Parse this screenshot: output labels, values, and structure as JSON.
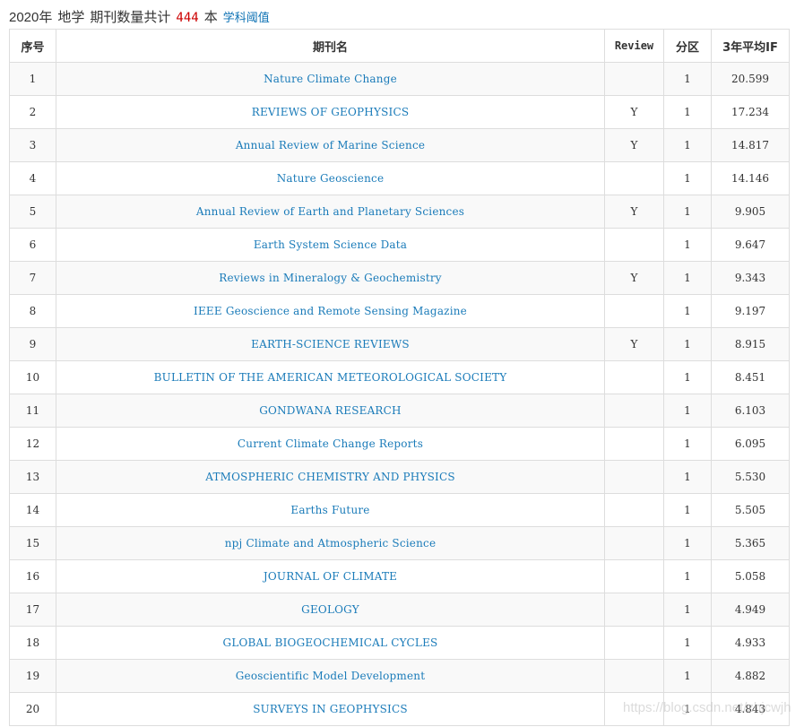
{
  "header": {
    "year": "2020年",
    "subject": "地学",
    "count_label": "期刊数量共计",
    "count": "444",
    "unit": "本",
    "threshold_link": "学科阈值"
  },
  "table": {
    "columns": {
      "no": "序号",
      "name": "期刊名",
      "review": "Review",
      "zone": "分区",
      "if3": "3年平均IF"
    },
    "rows": [
      {
        "no": "1",
        "name": "Nature Climate Change",
        "review": "",
        "zone": "1",
        "if3": "20.599"
      },
      {
        "no": "2",
        "name": "REVIEWS OF GEOPHYSICS",
        "review": "Y",
        "zone": "1",
        "if3": "17.234"
      },
      {
        "no": "3",
        "name": "Annual Review of Marine Science",
        "review": "Y",
        "zone": "1",
        "if3": "14.817"
      },
      {
        "no": "4",
        "name": "Nature Geoscience",
        "review": "",
        "zone": "1",
        "if3": "14.146"
      },
      {
        "no": "5",
        "name": "Annual Review of Earth and Planetary Sciences",
        "review": "Y",
        "zone": "1",
        "if3": "9.905"
      },
      {
        "no": "6",
        "name": "Earth System Science Data",
        "review": "",
        "zone": "1",
        "if3": "9.647"
      },
      {
        "no": "7",
        "name": "Reviews in Mineralogy & Geochemistry",
        "review": "Y",
        "zone": "1",
        "if3": "9.343"
      },
      {
        "no": "8",
        "name": "IEEE Geoscience and Remote Sensing Magazine",
        "review": "",
        "zone": "1",
        "if3": "9.197"
      },
      {
        "no": "9",
        "name": "EARTH-SCIENCE REVIEWS",
        "review": "Y",
        "zone": "1",
        "if3": "8.915"
      },
      {
        "no": "10",
        "name": "BULLETIN OF THE AMERICAN METEOROLOGICAL SOCIETY",
        "review": "",
        "zone": "1",
        "if3": "8.451"
      },
      {
        "no": "11",
        "name": "GONDWANA RESEARCH",
        "review": "",
        "zone": "1",
        "if3": "6.103"
      },
      {
        "no": "12",
        "name": "Current Climate Change Reports",
        "review": "",
        "zone": "1",
        "if3": "6.095"
      },
      {
        "no": "13",
        "name": "ATMOSPHERIC CHEMISTRY AND PHYSICS",
        "review": "",
        "zone": "1",
        "if3": "5.530"
      },
      {
        "no": "14",
        "name": "Earths Future",
        "review": "",
        "zone": "1",
        "if3": "5.505"
      },
      {
        "no": "15",
        "name": "npj Climate and Atmospheric Science",
        "review": "",
        "zone": "1",
        "if3": "5.365"
      },
      {
        "no": "16",
        "name": "JOURNAL OF CLIMATE",
        "review": "",
        "zone": "1",
        "if3": "5.058"
      },
      {
        "no": "17",
        "name": "GEOLOGY",
        "review": "",
        "zone": "1",
        "if3": "4.949"
      },
      {
        "no": "18",
        "name": "GLOBAL BIOGEOCHEMICAL CYCLES",
        "review": "",
        "zone": "1",
        "if3": "4.933"
      },
      {
        "no": "19",
        "name": "Geoscientific Model Development",
        "review": "",
        "zone": "1",
        "if3": "4.882"
      },
      {
        "no": "20",
        "name": "SURVEYS IN GEOPHYSICS",
        "review": "",
        "zone": "1",
        "if3": "4.843"
      }
    ]
  },
  "watermark": "https://blog.csdn.net/zhjcwjh"
}
